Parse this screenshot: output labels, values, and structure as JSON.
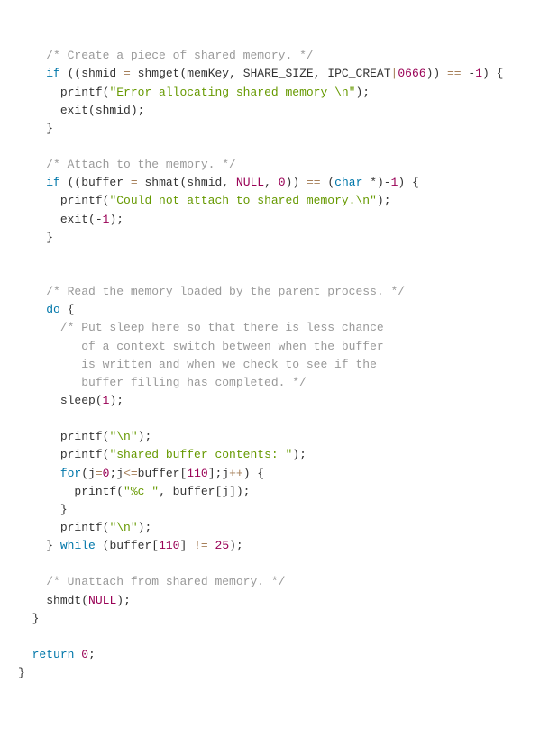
{
  "ind1": "    ",
  "ind2": "      ",
  "ind3": "        ",
  "ind0": "  ",
  "t": {
    "c_create": "/* Create a piece of shared memory. */",
    "kw_if1": "if",
    "lp": " ((shmid ",
    "assign1": "=",
    "sp": " ",
    "fn_shmget": "shmget",
    "shmget_open": "(memKey, SHARE_SIZE, IPC_CREAT",
    "pipe": "|",
    "octal": "0666",
    "shmget_close": ")) ",
    "eqeq1": "==",
    "neg1": " -",
    "one": "1",
    "if1_end": ") {",
    "fn_printf": "printf",
    "pr_open": "(",
    "s_err_alloc": "\"Error allocating shared memory \\n\"",
    "pr_close": ");",
    "fn_exit": "exit",
    "exit_shmid": "(shmid);",
    "rbrace": "}",
    "c_attach": "/* Attach to the memory. */",
    "kw_if2": "if",
    "if2_a": " ((buffer ",
    "fn_shmat": "shmat",
    "shmat_args": "(shmid, ",
    "null": "NULL",
    "comma_sp": ", ",
    "zero": "0",
    "shmat_close": ")) ",
    "eqeq2": "==",
    "cast_open": " (",
    "kw_char": "char",
    "cast_close": " *)-",
    "if2_end": ") {",
    "s_no_attach": "\"Could not attach to shared memory.\\n\"",
    "exit_neg1_a": "(-",
    "exit_neg1_b": ");",
    "c_read": "/* Read the memory loaded by the parent process. */",
    "kw_do": "do",
    "do_open": " {",
    "c_sleep1": "/* Put sleep here so that there is less chance",
    "c_sleep2": "   of a context switch between when the buffer",
    "c_sleep3": "   is written and when we check to see if the",
    "c_sleep4": "   buffer filling has completed. */",
    "fn_sleep": "sleep",
    "sleep_args_a": "(",
    "sleep_args_b": ");",
    "s_nl": "\"\\n\"",
    "s_sbc": "\"shared buffer contents: \"",
    "kw_for": "for",
    "for_a": "(j",
    "for_b": ";j",
    "lteq": "<=",
    "buf110": "buffer[",
    "n110": "110",
    "for_c": "];j",
    "pp": "++",
    "for_d": ") {",
    "s_pc_c": "\"%c \"",
    "inner_printf_b": ", buffer[j]);",
    "kw_while": "while",
    "while_a": " (buffer[",
    "while_b": "] ",
    "neq": "!=",
    "n25": "25",
    "while_c": ");",
    "c_unattach": "/* Unattach from shared memory. */",
    "fn_shmdt": "shmdt",
    "shmdt_args_a": "(",
    "shmdt_args_b": ");",
    "kw_return": "return",
    "ret_zero": "0",
    "semi": ";"
  }
}
